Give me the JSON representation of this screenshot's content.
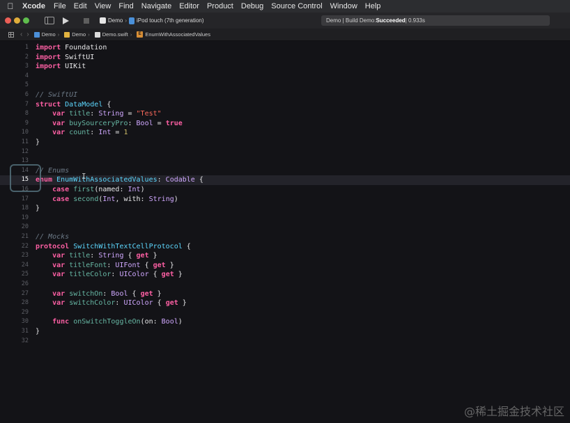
{
  "menubar": {
    "app": "Xcode",
    "items": [
      "File",
      "Edit",
      "View",
      "Find",
      "Navigate",
      "Editor",
      "Product",
      "Debug",
      "Source Control",
      "Window",
      "Help"
    ]
  },
  "toolbar": {
    "scheme": "Demo",
    "device": "iPod touch (7th generation)",
    "status_prefix": "Demo | Build Demo: ",
    "status_result": "Succeeded",
    "status_time": " | 0.933s"
  },
  "jumpbar": {
    "crumbs": [
      "Demo",
      "Demo",
      "Demo.swift",
      "EnumWithAssociatedValues"
    ],
    "enum_badge": "E"
  },
  "editor": {
    "current_line": 15,
    "lines": [
      {
        "n": "1",
        "t": "import Foundation"
      },
      {
        "n": "2",
        "t": "import SwiftUI"
      },
      {
        "n": "3",
        "t": "import UIKit"
      },
      {
        "n": "4",
        "t": ""
      },
      {
        "n": "5",
        "t": ""
      },
      {
        "n": "6",
        "t": "// SwiftUI"
      },
      {
        "n": "7",
        "t": "struct DataModel {"
      },
      {
        "n": "8",
        "t": "    var title: String = \"Test\""
      },
      {
        "n": "9",
        "t": "    var buySourceryPro: Bool = true"
      },
      {
        "n": "10",
        "t": "    var count: Int = 1"
      },
      {
        "n": "11",
        "t": "}"
      },
      {
        "n": "12",
        "t": ""
      },
      {
        "n": "13",
        "t": ""
      },
      {
        "n": "14",
        "t": "// Enums"
      },
      {
        "n": "15",
        "t": "enum EnumWithAssociatedValues: Codable {"
      },
      {
        "n": "16",
        "t": "    case first(named: Int)"
      },
      {
        "n": "17",
        "t": "    case second(Int, with: String)"
      },
      {
        "n": "18",
        "t": "}"
      },
      {
        "n": "19",
        "t": ""
      },
      {
        "n": "20",
        "t": ""
      },
      {
        "n": "21",
        "t": "// Mocks"
      },
      {
        "n": "22",
        "t": "protocol SwitchWithTextCellProtocol {"
      },
      {
        "n": "23",
        "t": "    var title: String { get }"
      },
      {
        "n": "24",
        "t": "    var titleFont: UIFont { get }"
      },
      {
        "n": "25",
        "t": "    var titleColor: UIColor { get }"
      },
      {
        "n": "26",
        "t": ""
      },
      {
        "n": "27",
        "t": "    var switchOn: Bool { get }"
      },
      {
        "n": "28",
        "t": "    var switchColor: UIColor { get }"
      },
      {
        "n": "29",
        "t": ""
      },
      {
        "n": "30",
        "t": "    func onSwitchToggleOn(on: Bool)"
      },
      {
        "n": "31",
        "t": "}"
      },
      {
        "n": "32",
        "t": ""
      }
    ]
  },
  "watermark": "@稀土掘金技术社区",
  "colors": {
    "keyword": "#fc5fa3",
    "type": "#d0a8ff",
    "string": "#fc6a5d",
    "number": "#d0bf69",
    "comment": "#6c7986",
    "declaration": "#41a1c0"
  }
}
